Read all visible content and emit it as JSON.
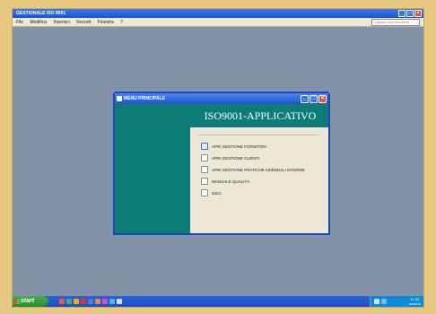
{
  "window": {
    "title": "GESTIONALE ISO 9001",
    "controls": [
      "_",
      "□",
      "×"
    ]
  },
  "menubar": {
    "items": [
      "File",
      "Modifica",
      "Inserisci",
      "Record",
      "Finestra",
      "?"
    ],
    "help_placeholder": "Digitare una domanda"
  },
  "dialog": {
    "title": "MENU PRINCIPALE",
    "controls": [
      "_",
      "□",
      "×"
    ],
    "app_title": "ISO9001-APPLICATIVO",
    "items": [
      "APRI GESTIONE FORNITORI",
      "APRI GESTIONE CLIENTI",
      "APRI GESTIONE PRATICHE AZIENDALI INTERNE",
      "MANUALE QUALITÀ",
      "ESCI"
    ]
  },
  "taskbar": {
    "start_label": "start",
    "clock_time": "11:33",
    "clock_day": "venerdì",
    "quick_launch_colors": [
      "#e54",
      "#4a8",
      "#fa0",
      "#d33",
      "#57d",
      "#e84",
      "#c5c",
      "#4bd",
      "#ddd"
    ]
  }
}
